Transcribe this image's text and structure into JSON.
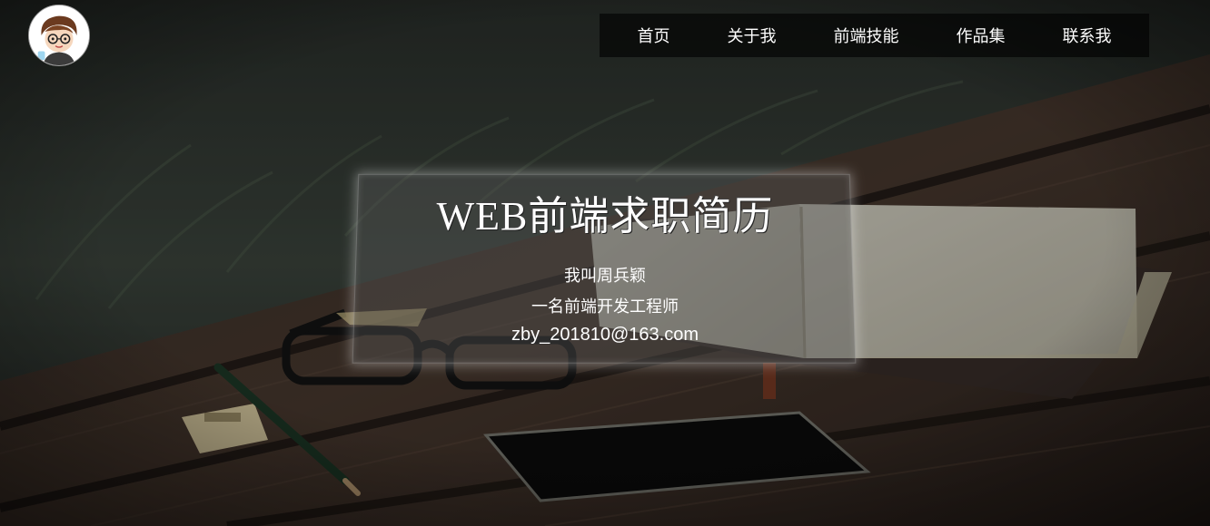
{
  "nav": {
    "items": [
      {
        "label": "首页"
      },
      {
        "label": "关于我"
      },
      {
        "label": "前端技能"
      },
      {
        "label": "作品集"
      },
      {
        "label": "联系我"
      }
    ]
  },
  "hero": {
    "title": "WEB前端求职简历",
    "name_line": "我叫周兵颖",
    "role_line": "一名前端开发工程师",
    "email": "zby_201810@163.com"
  },
  "icons": {
    "avatar": "avatar-cartoon-boy"
  }
}
